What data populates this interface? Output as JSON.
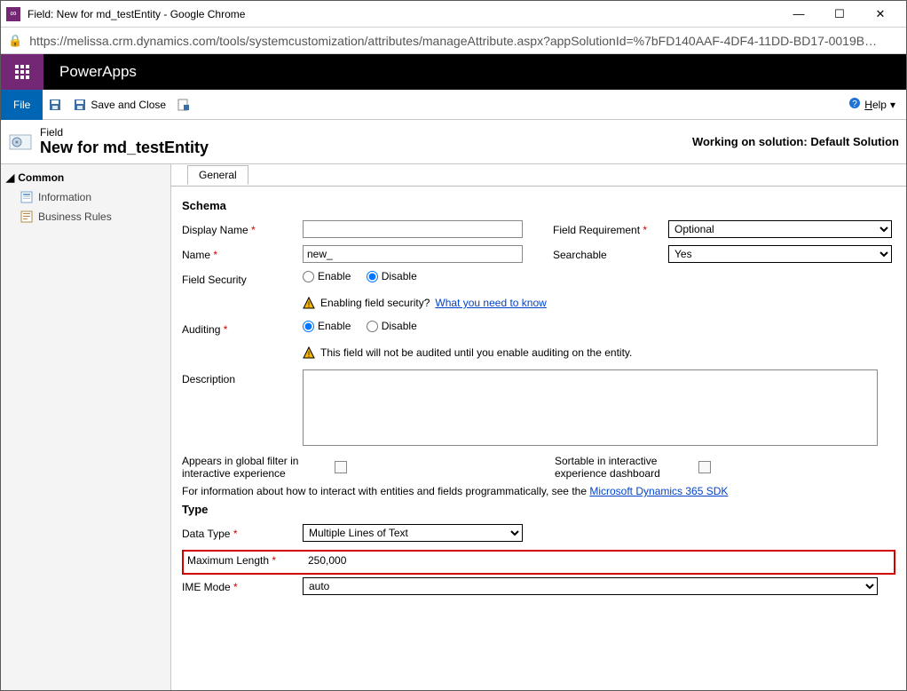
{
  "window": {
    "title": "Field: New for md_testEntity - Google Chrome",
    "url": "https://melissa.crm.dynamics.com/tools/systemcustomization/attributes/manageAttribute.aspx?appSolutionId=%7bFD140AAF-4DF4-11DD-BD17-0019B93..."
  },
  "header": {
    "brand": "PowerApps"
  },
  "cmdbar": {
    "file": "File",
    "save_close": "Save and Close",
    "help": "Help"
  },
  "formheader": {
    "small": "Field",
    "big": "New for md_testEntity",
    "working_label": "Working on solution:",
    "working_value": "Default Solution"
  },
  "sidebar": {
    "head": "Common",
    "items": [
      {
        "label": "Information"
      },
      {
        "label": "Business Rules"
      }
    ]
  },
  "tabs": {
    "general": "General"
  },
  "schema": {
    "section": "Schema",
    "display_name_label": "Display Name",
    "display_name_value": "",
    "field_req_label": "Field Requirement",
    "field_req_value": "Optional",
    "name_label": "Name",
    "name_value": "new_",
    "searchable_label": "Searchable",
    "searchable_value": "Yes",
    "field_security_label": "Field Security",
    "enable": "Enable",
    "disable": "Disable",
    "fs_warning": "Enabling field security?",
    "fs_link": "What you need to know",
    "auditing_label": "Auditing",
    "auditing_warning": "This field will not be audited until you enable auditing on the entity.",
    "description_label": "Description",
    "description_value": "",
    "appears_filter_label": "Appears in global filter in interactive experience",
    "sortable_label": "Sortable in interactive experience dashboard",
    "sdk_text": "For information about how to interact with entities and fields programmatically, see the ",
    "sdk_link": "Microsoft Dynamics 365 SDK"
  },
  "type": {
    "section": "Type",
    "data_type_label": "Data Type",
    "data_type_value": "Multiple Lines of Text",
    "max_len_label": "Maximum Length",
    "max_len_value": "250,000",
    "ime_label": "IME Mode",
    "ime_value": "auto"
  }
}
